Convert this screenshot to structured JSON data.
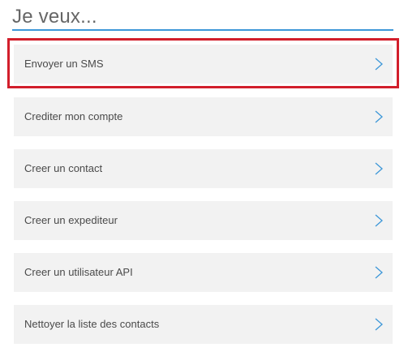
{
  "heading": {
    "title": "Je veux..."
  },
  "actions": [
    {
      "label": "Envoyer un SMS",
      "highlighted": true
    },
    {
      "label": "Crediter mon compte",
      "highlighted": false
    },
    {
      "label": "Creer un contact",
      "highlighted": false
    },
    {
      "label": "Creer un expediteur",
      "highlighted": false
    },
    {
      "label": "Creer un utilisateur API",
      "highlighted": false
    },
    {
      "label": "Nettoyer la liste des contacts",
      "highlighted": false
    }
  ],
  "icons": {
    "row_arrow": "chevron-right-icon"
  },
  "colors": {
    "accent": "#3d97d8",
    "highlight": "#d21e2b",
    "row_background": "#f2f2f2",
    "heading_text": "#666666",
    "row_text": "#4a4a4a"
  }
}
